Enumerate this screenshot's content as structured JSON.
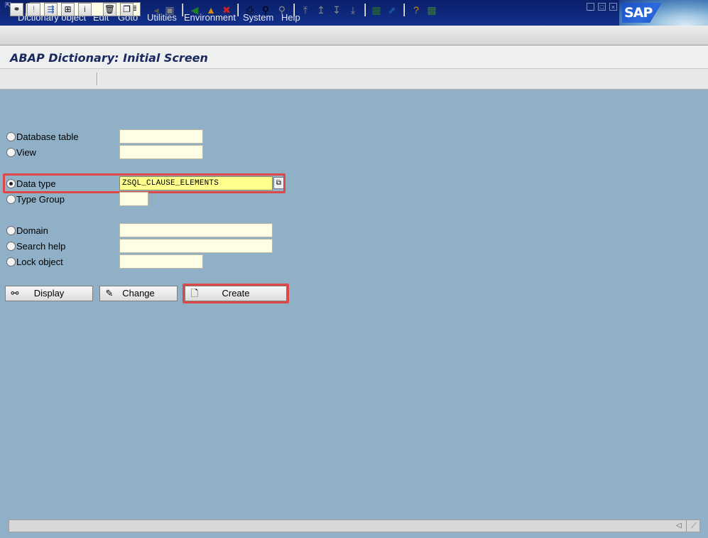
{
  "menu": {
    "items": [
      "Dictionary object",
      "Edit",
      "Goto",
      "Utilities",
      "Environment",
      "System",
      "Help"
    ],
    "window_buttons": [
      "_",
      "□",
      "×"
    ],
    "logo": "SAP"
  },
  "toolbar": {
    "command_field_value": "",
    "icons": [
      "enter-icon",
      "back-icon",
      "exit-icon",
      "cancel-icon",
      "print-icon",
      "find-icon",
      "find-next-icon",
      "first-page-icon",
      "previous-page-icon",
      "next-page-icon",
      "last-page-icon",
      "create-session-icon",
      "shortcut-icon",
      "help-icon",
      "layout-menu-icon"
    ]
  },
  "page": {
    "title": "ABAP Dictionary: Initial Screen"
  },
  "app_toolbar": {
    "icons": [
      "other-object-icon",
      "check-icon",
      "where-used-icon",
      "display-object-list-icon",
      "info-icon",
      "delete-icon",
      "copy-icon"
    ]
  },
  "form": {
    "database_table_label": "Database table",
    "view_label": "View",
    "data_type_label": "Data type",
    "data_type_value": "ZSQL_CLAUSE_ELEMENTS",
    "type_group_label": "Type Group",
    "domain_label": "Domain",
    "search_help_label": "Search help",
    "lock_object_label": "Lock object",
    "selected": "data_type"
  },
  "buttons": {
    "display_label": "Display",
    "change_label": "Change",
    "create_label": "Create"
  },
  "colors": {
    "background": "#8fb0c7",
    "menu_bar": "#0a1f6a",
    "highlight": "#e04848",
    "input_active": "#ffff8e",
    "input": "#fffde6"
  }
}
